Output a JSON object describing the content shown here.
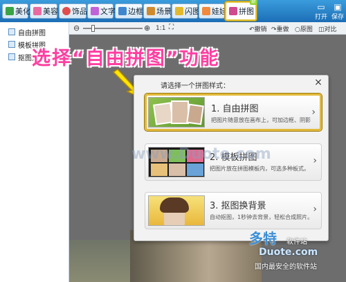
{
  "toolbar": {
    "tabs": [
      {
        "label": "美化",
        "color": "#3aa346"
      },
      {
        "label": "美容",
        "color": "#e86aa0"
      },
      {
        "label": "饰品",
        "color": "#e04d4d"
      },
      {
        "label": "文字",
        "color": "#c262d8"
      },
      {
        "label": "边框",
        "color": "#3f86cf"
      },
      {
        "label": "场景",
        "color": "#d08a2e"
      },
      {
        "label": "闪图",
        "color": "#e2b92e"
      },
      {
        "label": "娃娃",
        "color": "#f08a3e"
      },
      {
        "label": "拼图",
        "color": "#d04a8f",
        "badge": "新"
      }
    ],
    "open_label": "打开",
    "save_label": "保存"
  },
  "sidebar": {
    "items": [
      {
        "label": "自由拼图"
      },
      {
        "label": "模板拼图"
      },
      {
        "label": "抠图换背景"
      }
    ]
  },
  "subbar": {
    "zoom_out": "⊖",
    "zoom_in": "⊕",
    "ratio": "1:1",
    "fit": "⛶",
    "undo": "撤销",
    "redo": "重做",
    "original": "原图",
    "compare": "对比"
  },
  "headline": "选择“自由拼图”功能",
  "dialog": {
    "title": "请选择一个拼图样式：",
    "close": "×",
    "options": [
      {
        "title": "1. 自由拼图",
        "desc": "把图片随意放在画布上，可加边框、阴影",
        "selected": true
      },
      {
        "title": "2. 模板拼图",
        "desc": "把图片放在拼图模板内，可选多种板式。",
        "selected": false
      },
      {
        "title": "3. 抠图换背景",
        "desc": "自动抠图，1秒钟去背景，轻松合成照片。",
        "selected": false
      }
    ]
  },
  "watermark": {
    "logo": "多特",
    "logo_sub": "软件站",
    "url": "Duote.com",
    "slogan": "国内最安全的软件站",
    "center": "www.Duote.com"
  }
}
